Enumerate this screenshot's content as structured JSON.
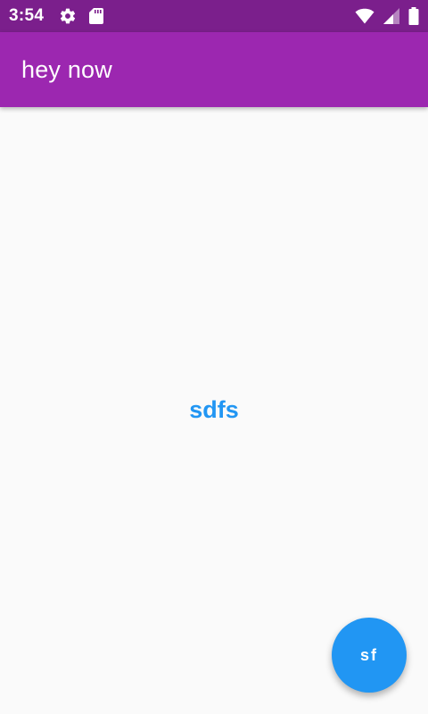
{
  "status_bar": {
    "time": "3:54",
    "left_icons": [
      "gear-icon",
      "sd-card-icon"
    ],
    "right_icons": [
      "wifi-icon",
      "cell-signal-icon",
      "battery-icon"
    ],
    "background": "#7b1f8c"
  },
  "app_bar": {
    "title": "hey now",
    "background": "#9c27b0"
  },
  "main": {
    "center_text": "sdfs",
    "text_color": "#2196f3",
    "background": "#fafafa"
  },
  "fab": {
    "label": "sf",
    "background": "#2196f3"
  }
}
